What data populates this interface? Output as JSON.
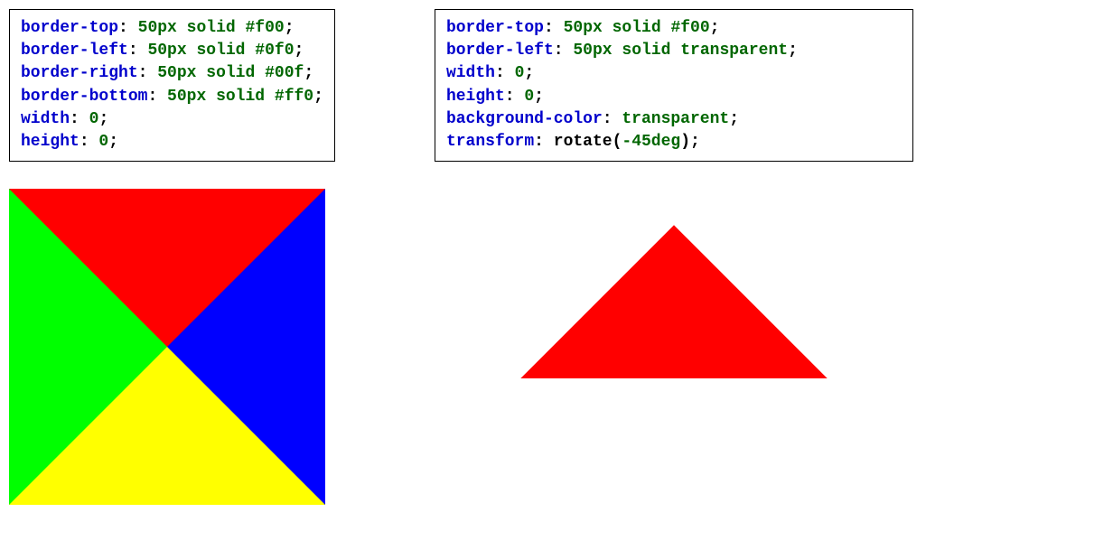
{
  "left": {
    "code": [
      {
        "prop": "border-top",
        "val_num": "50",
        "val_unit": "px",
        "kw": "solid",
        "color": "#f00"
      },
      {
        "prop": "border-left",
        "val_num": "50",
        "val_unit": "px",
        "kw": "solid",
        "color": "#0f0"
      },
      {
        "prop": "border-right",
        "val_num": "50",
        "val_unit": "px",
        "kw": "solid",
        "color": "#00f"
      },
      {
        "prop": "border-bottom",
        "val_num": "50",
        "val_unit": "px",
        "kw": "solid",
        "color": "#ff0"
      },
      {
        "prop": "width",
        "val_num": "0"
      },
      {
        "prop": "height",
        "val_num": "0"
      }
    ]
  },
  "right": {
    "code": [
      {
        "prop": "border-top",
        "val_num": "50",
        "val_unit": "px",
        "kw": "solid",
        "color": "#f00"
      },
      {
        "prop": "border-left",
        "val_num": "50",
        "val_unit": "px",
        "kw": "solid",
        "color_kw": "transparent"
      },
      {
        "prop": "width",
        "val_num": "0"
      },
      {
        "prop": "height",
        "val_num": "0"
      },
      {
        "prop": "background-color",
        "color_kw": "transparent"
      },
      {
        "prop": "transform",
        "fn": "rotate",
        "fn_num": "-45",
        "fn_unit": "deg"
      }
    ]
  },
  "shapes": {
    "left_colors": {
      "top": "#f00",
      "left": "#0f0",
      "right": "#00f",
      "bottom": "#ff0"
    },
    "right_color": "#f00"
  }
}
